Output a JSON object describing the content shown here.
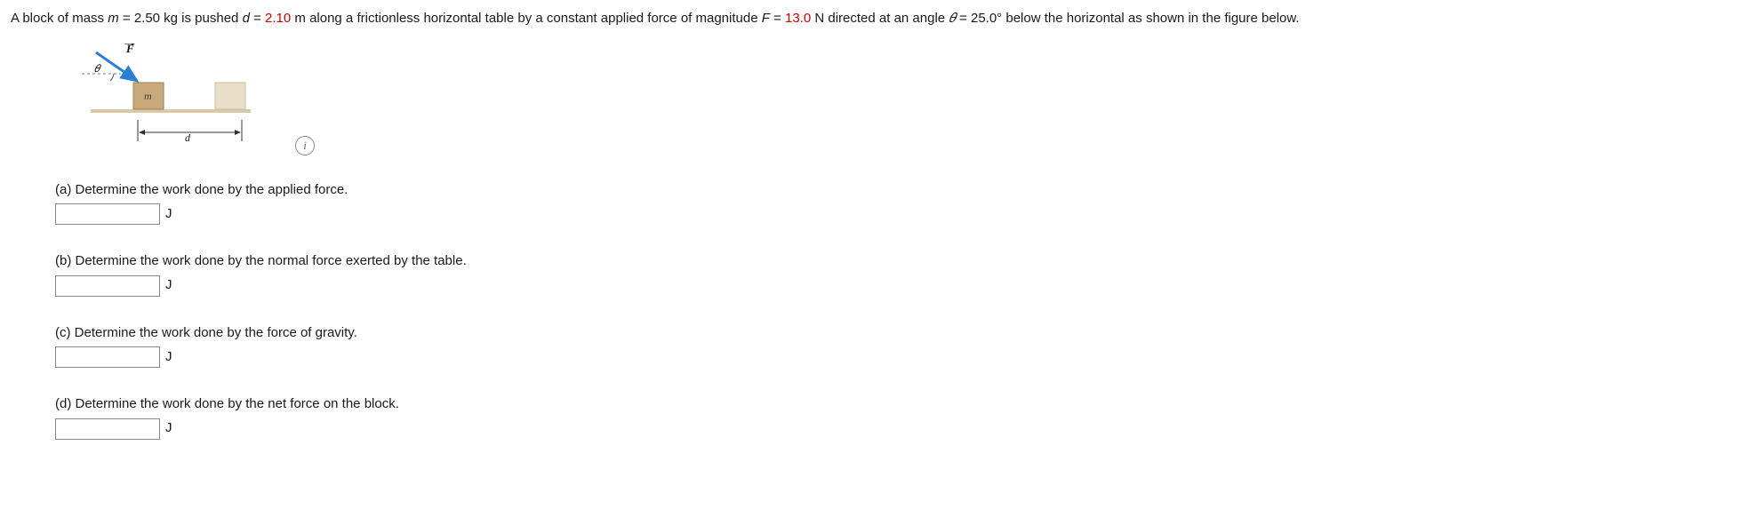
{
  "problem": {
    "pre1": "A block of mass ",
    "m_sym": "m",
    "eq1": " = 2.50 kg is pushed ",
    "d_sym": "d",
    "eq2": " = ",
    "d_val": "2.10",
    "post_d": " m along a frictionless horizontal table by a constant applied force of magnitude ",
    "F_sym": "F",
    "eq3": " = ",
    "F_val": "13.0",
    "post_F": " N directed at an angle ",
    "theta_sym": "𝜃",
    "eq4": " = 25.0° below the horizontal as shown in the figure below."
  },
  "figure": {
    "F_label": "F",
    "theta_label": "𝜃",
    "m_label": "m",
    "d_label": "d"
  },
  "info_tooltip": "i",
  "parts": {
    "a": {
      "label": "(a) Determine the work done by the applied force.",
      "unit": "J"
    },
    "b": {
      "label": "(b) Determine the work done by the normal force exerted by the table.",
      "unit": "J"
    },
    "c": {
      "label": "(c) Determine the work done by the force of gravity.",
      "unit": "J"
    },
    "d": {
      "label": "(d) Determine the work done by the net force on the block.",
      "unit": "J"
    }
  }
}
